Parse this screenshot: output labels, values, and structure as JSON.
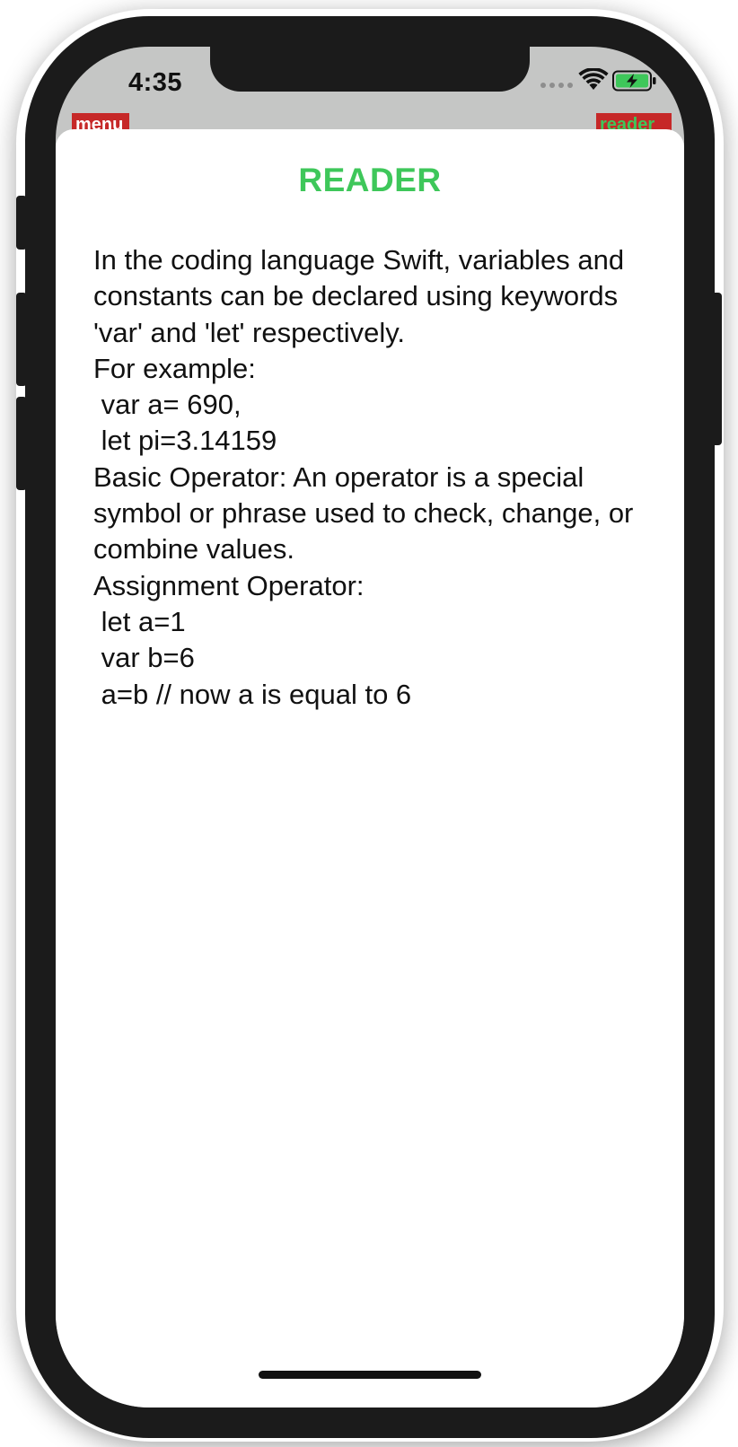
{
  "status_bar": {
    "time": "4:35",
    "icons": [
      "cellular-dots-icon",
      "wifi-icon",
      "battery-charging-icon"
    ],
    "battery_color": "#3ec75a"
  },
  "nav": {
    "menu_label": "menu",
    "reader_label": "reader",
    "button_color": "#c62828"
  },
  "reader": {
    "title": "READER",
    "title_color": "#3ec75a",
    "body": "In the coding language Swift, variables and constants can be declared using keywords 'var' and 'let' respectively.\nFor example:\n var a= 690,\n let pi=3.14159\nBasic Operator: An operator is a special symbol or phrase used to check, change, or combine values.\nAssignment Operator:\n let a=1\n var b=6\n a=b // now a is equal to 6"
  }
}
